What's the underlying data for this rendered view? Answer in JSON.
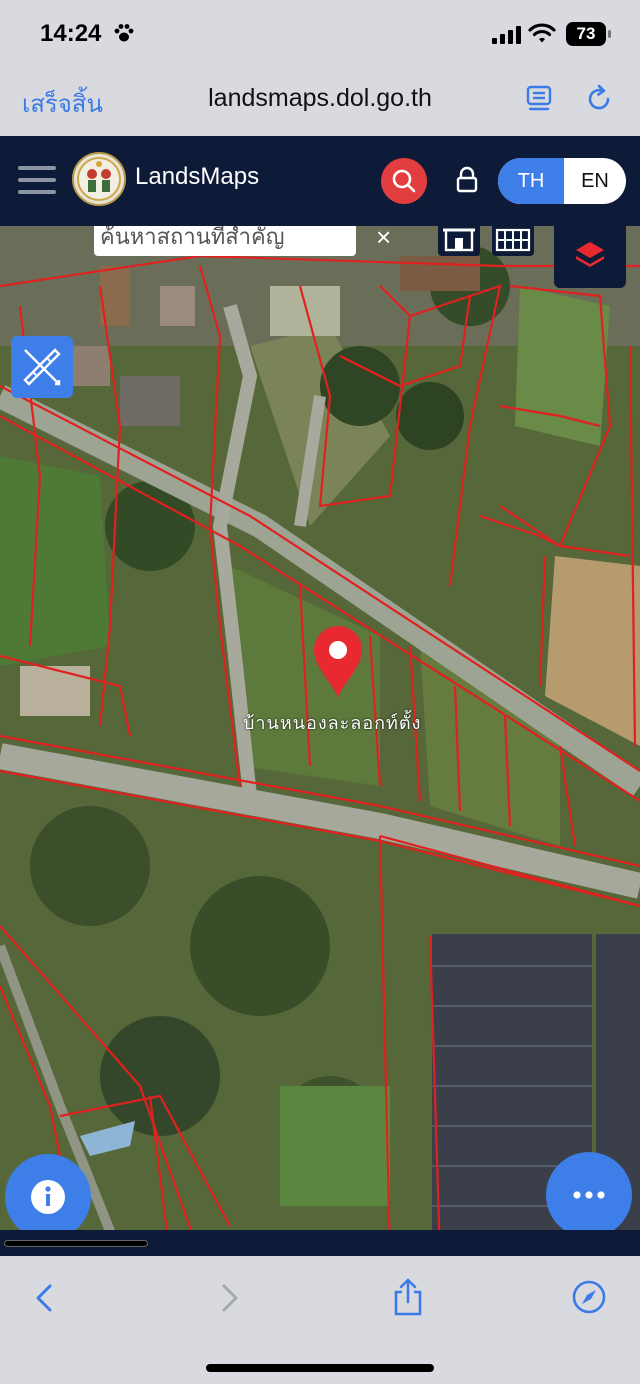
{
  "status_bar": {
    "time": "14:24",
    "battery": "73"
  },
  "browser": {
    "done_label": "เสร็จสิ้น",
    "url": "landsmaps.dol.go.th"
  },
  "app": {
    "brand": "LandsMaps",
    "language": {
      "th_label": "TH",
      "en_label": "EN",
      "selected": "TH"
    }
  },
  "map": {
    "search_placeholder": "ค้นหาสถานที่สำคัญ",
    "parcel_label": "บ้านหนองละลอกท์ตั้ง",
    "imagery": "satellite",
    "parcel_outline_color": "#e0211f"
  },
  "colors": {
    "header_bg": "#0e1b38",
    "accent_blue": "#3e7ee8",
    "search_red": "#e23d3f",
    "pin_red": "#e8292f"
  },
  "icons": [
    "paw-icon",
    "signal-icon",
    "wifi-icon",
    "reader-icon",
    "reload-icon",
    "menu-icon",
    "search-icon",
    "lock-icon",
    "building-icon",
    "grid-icon",
    "layers-icon",
    "ruler-pencil-icon",
    "map-pin-icon",
    "info-icon",
    "more-icon",
    "back-icon",
    "forward-icon",
    "share-icon",
    "compass-icon"
  ]
}
